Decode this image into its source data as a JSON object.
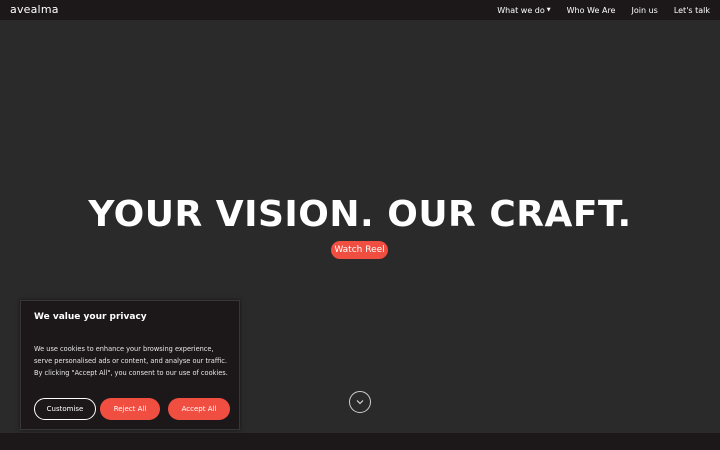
{
  "brand": {
    "logo_text": "avealma"
  },
  "nav": {
    "items": [
      {
        "label": "What we do",
        "has_dropdown": true
      },
      {
        "label": "Who We Are"
      },
      {
        "label": "Join us"
      },
      {
        "label": "Let's talk"
      }
    ]
  },
  "hero": {
    "headline": "YOUR VISION. OUR CRAFT.",
    "cta_label": "Watch Reel",
    "scroll_icon": "chevron-down-icon"
  },
  "cookie_banner": {
    "title": "We value your privacy",
    "body": "We use cookies to enhance your browsing experience, serve personalised ads or content, and analyse our traffic. By clicking \"Accept All\", you consent to our use of cookies.",
    "customise_label": "Customise",
    "reject_label": "Reject All",
    "accept_label": "Accept All"
  },
  "colors": {
    "background": "#2b2a2b",
    "topbar": "#1c1819",
    "accent": "#f14e42",
    "text": "#ffffff"
  }
}
